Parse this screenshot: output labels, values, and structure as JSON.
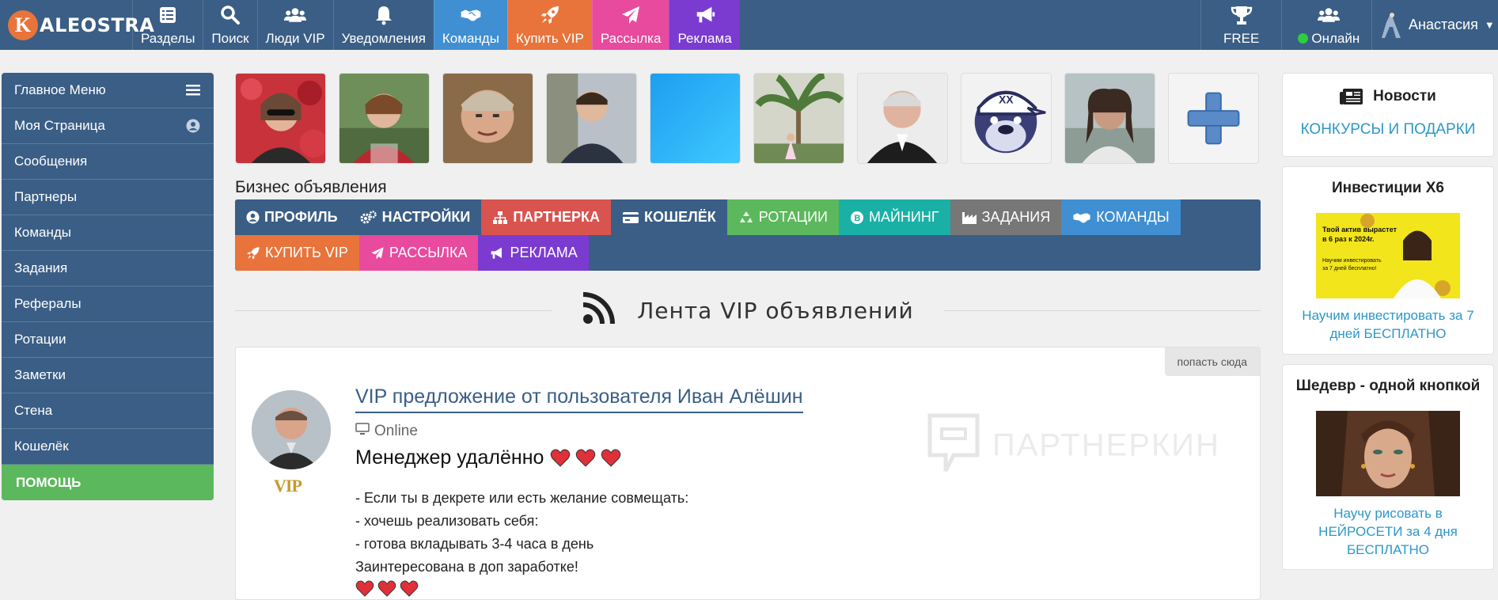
{
  "brand": {
    "logo_letter": "K",
    "logo_text": "ALEOSTRA"
  },
  "nav": {
    "items": [
      {
        "label": "Разделы",
        "icon": "list-icon",
        "color": ""
      },
      {
        "label": "Поиск",
        "icon": "search-icon",
        "color": ""
      },
      {
        "label": "Люди VIP",
        "icon": "users-icon",
        "color": ""
      },
      {
        "label": "Уведомления",
        "icon": "bell-icon",
        "color": ""
      },
      {
        "label": "Команды",
        "icon": "handshake-icon",
        "color": "#3f8fd2"
      },
      {
        "label": "Купить VIP",
        "icon": "rocket-icon",
        "color": "#e8743b"
      },
      {
        "label": "Рассылка",
        "icon": "paper-plane-icon",
        "color": "#e84a9e"
      },
      {
        "label": "Реклама",
        "icon": "megaphone-icon",
        "color": "#7b3bd0"
      }
    ],
    "right": [
      {
        "label": "FREE",
        "icon": "trophy-icon"
      },
      {
        "label": "Онлайн",
        "icon": "users-icon"
      }
    ],
    "user_name": "Анастасия"
  },
  "sidebar": {
    "items": [
      {
        "label": "Главное Меню",
        "icon": "hamburger-icon"
      },
      {
        "label": "Моя Страница",
        "icon": "user-circle-icon"
      },
      {
        "label": "Сообщения"
      },
      {
        "label": "Партнеры"
      },
      {
        "label": "Команды"
      },
      {
        "label": "Задания"
      },
      {
        "label": "Рефералы"
      },
      {
        "label": "Ротации"
      },
      {
        "label": "Заметки"
      },
      {
        "label": "Стена"
      },
      {
        "label": "Кошелёк"
      }
    ],
    "help_label": "ПОМОЩЬ"
  },
  "main": {
    "business_title": "Бизнес объявления",
    "tabs": [
      {
        "label": "ПРОФИЛЬ",
        "icon": "user-circle-icon",
        "color": "#3a5e85",
        "bold": true
      },
      {
        "label": "НАСТРОЙКИ",
        "icon": "gears-icon",
        "color": "#3a5e85",
        "bold": true
      },
      {
        "label": "ПАРТНЕРКА",
        "icon": "sitemap-icon",
        "color": "#d9534f",
        "bold": true
      },
      {
        "label": "КОШЕЛЁК",
        "icon": "credit-card-icon",
        "color": "#3a5e85",
        "bold": true
      },
      {
        "label": "РОТАЦИИ",
        "icon": "recycle-icon",
        "color": "#5cb85c",
        "bold": false
      },
      {
        "label": "МАЙНИНГ",
        "icon": "bitcoin-icon",
        "color": "#1ab0a6",
        "bold": false
      },
      {
        "label": "ЗАДАНИЯ",
        "icon": "industry-icon",
        "color": "#777777",
        "bold": false
      },
      {
        "label": "КОМАНДЫ",
        "icon": "handshake-icon",
        "color": "#3f8fd2",
        "bold": false
      },
      {
        "label": "КУПИТЬ VIP",
        "icon": "rocket-icon",
        "color": "#e8743b",
        "bold": false
      },
      {
        "label": "РАССЫЛКА",
        "icon": "paper-plane-icon",
        "color": "#e84a9e",
        "bold": false
      },
      {
        "label": "РЕКЛАМА",
        "icon": "megaphone-icon",
        "color": "#7b3bd0",
        "bold": false
      }
    ],
    "feed_title": "Лента VIP объявлений",
    "card": {
      "corner_label": "попасть сюда",
      "title": "VIP предложение от пользователя Иван Алёшин",
      "status": "Online",
      "vip_badge": "VIP",
      "headline": "Менеджер удалённо",
      "lines": [
        "- Если ты в декрете или есть желание совмещать:",
        "- хочешь реализовать себя:",
        "- готова вкладывать 3-4 часа в день",
        "Заинтересована в доп заработке!"
      ]
    },
    "watermark": "ПАРТНЕРКИН"
  },
  "right": {
    "news_title": "Новости",
    "news_link": "КОНКУРСЫ И ПОДАРКИ",
    "boxes": [
      {
        "title": "Инвестиции Х6",
        "banner_line1": "Твой актив вырастет",
        "banner_line2": "в 6 раз к 2024г.",
        "banner_line3": "Научим инвестировать",
        "banner_line4": "за 7 дней бесплатно!",
        "link": "Научим инвестировать за 7 дней БЕСПЛАТНО"
      },
      {
        "title": "Шедевр - одной кнопкой",
        "link": "Научу рисовать в НЕЙРОСЕТИ за 4 дня БЕСПЛАТНО"
      }
    ]
  }
}
